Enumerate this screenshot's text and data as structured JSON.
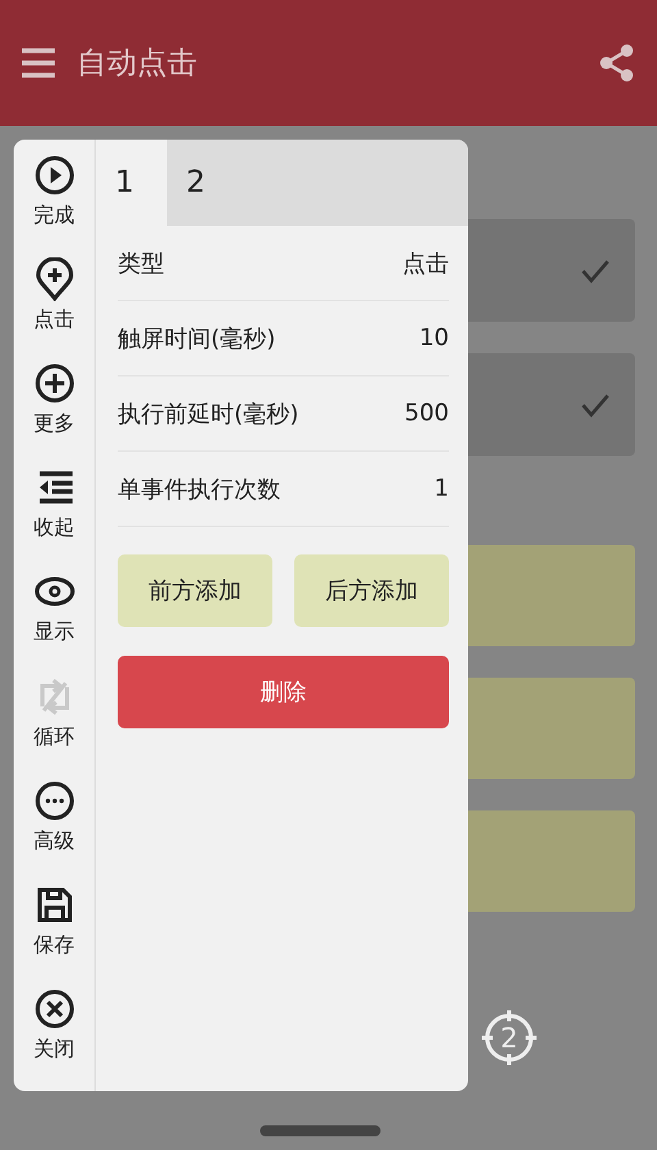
{
  "app_bar": {
    "title": "自动点击"
  },
  "settings_rows": [
    {
      "checked": true
    },
    {
      "checked": true
    }
  ],
  "cards": [
    {
      "kind": "action-card"
    },
    {
      "kind": "action-card"
    },
    {
      "kind": "action-card"
    }
  ],
  "markers": [
    {
      "label": "2"
    }
  ],
  "toolbar": [
    {
      "label": "完成",
      "kind": "play",
      "disabled": false
    },
    {
      "label": "点击",
      "kind": "pin",
      "disabled": false
    },
    {
      "label": "更多",
      "kind": "plus",
      "disabled": false
    },
    {
      "label": "收起",
      "kind": "collapse",
      "disabled": false
    },
    {
      "label": "显示",
      "kind": "eye",
      "disabled": false
    },
    {
      "label": "循环",
      "kind": "loop",
      "disabled": true
    },
    {
      "label": "高级",
      "kind": "more",
      "disabled": false
    },
    {
      "label": "保存",
      "kind": "save",
      "disabled": false
    },
    {
      "label": "关闭",
      "kind": "close",
      "disabled": false
    }
  ],
  "tabs": [
    {
      "label": "1",
      "selected": true
    },
    {
      "label": "2",
      "selected": false
    }
  ],
  "fields": [
    {
      "label": "类型",
      "value": "点击"
    },
    {
      "label": "触屏时间(毫秒)",
      "value": "10"
    },
    {
      "label": "执行前延时(毫秒)",
      "value": "500"
    },
    {
      "label": "单事件执行次数",
      "value": "1"
    }
  ],
  "buttons": [
    {
      "label": "前方添加",
      "kind": "add"
    },
    {
      "label": "后方添加",
      "kind": "add"
    },
    {
      "label": "删除",
      "kind": "danger"
    }
  ]
}
